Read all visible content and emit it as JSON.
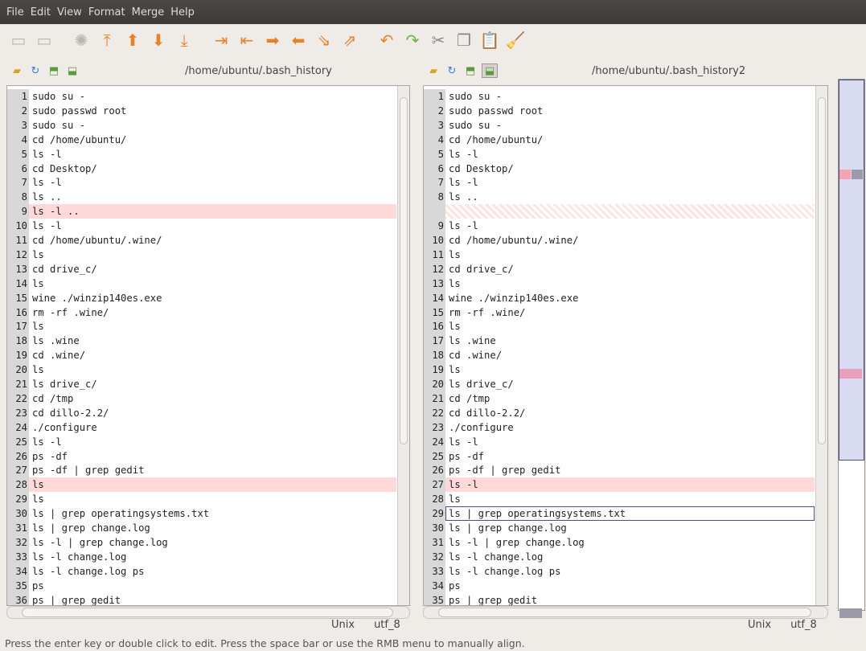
{
  "menu": [
    "File",
    "Edit",
    "View",
    "Format",
    "Merge",
    "Help"
  ],
  "toolbar": {
    "icons": [
      "new-file-icon",
      "open-file-icon",
      "spinner-icon",
      "move-first-change-icon",
      "move-prev-change-icon",
      "move-next-change-icon",
      "move-last-change-icon",
      "copy-right-icon",
      "copy-left-right-icon",
      "copy-right-arrow-icon",
      "copy-left-icon",
      "copy-all-icon",
      "merge-icon",
      "undo-icon",
      "redo-icon",
      "cut-icon",
      "copy-icon",
      "paste-icon",
      "clear-icon"
    ]
  },
  "left": {
    "path": "/home/ubuntu/.bash_history",
    "encoding_eol": "Unix",
    "encoding": "utf_8",
    "lines": [
      {
        "n": "1",
        "t": "sudo su -"
      },
      {
        "n": "2",
        "t": "sudo passwd root"
      },
      {
        "n": "3",
        "t": "sudo su -"
      },
      {
        "n": "4",
        "t": "cd /home/ubuntu/"
      },
      {
        "n": "5",
        "t": "ls -l"
      },
      {
        "n": "6",
        "t": "cd Desktop/"
      },
      {
        "n": "7",
        "t": "ls -l"
      },
      {
        "n": "8",
        "t": "ls .."
      },
      {
        "n": "9",
        "t": "ls -l ..",
        "chg": true
      },
      {
        "n": "10",
        "t": "ls -l"
      },
      {
        "n": "11",
        "t": "cd /home/ubuntu/.wine/"
      },
      {
        "n": "12",
        "t": "ls"
      },
      {
        "n": "13",
        "t": "cd drive_c/"
      },
      {
        "n": "14",
        "t": "ls"
      },
      {
        "n": "15",
        "t": "wine ./winzip140es.exe"
      },
      {
        "n": "16",
        "t": "rm -rf .wine/"
      },
      {
        "n": "17",
        "t": "ls"
      },
      {
        "n": "18",
        "t": "ls .wine"
      },
      {
        "n": "19",
        "t": "cd .wine/"
      },
      {
        "n": "20",
        "t": "ls"
      },
      {
        "n": "21",
        "t": "ls drive_c/"
      },
      {
        "n": "22",
        "t": "cd /tmp"
      },
      {
        "n": "23",
        "t": "cd dillo-2.2/"
      },
      {
        "n": "24",
        "t": "./configure"
      },
      {
        "n": "25",
        "t": "ls -l"
      },
      {
        "n": "26",
        "t": "ps -df"
      },
      {
        "n": "27",
        "t": "ps -df | grep gedit"
      },
      {
        "n": "28",
        "t": "ls",
        "chg": true
      },
      {
        "n": "29",
        "t": "ls"
      },
      {
        "n": "30",
        "t": "ls | grep operatingsystems.txt"
      },
      {
        "n": "31",
        "t": "ls | grep change.log"
      },
      {
        "n": "32",
        "t": "ls -l | grep change.log"
      },
      {
        "n": "33",
        "t": "ls -l change.log"
      },
      {
        "n": "34",
        "t": "ls -l change.log ps"
      },
      {
        "n": "35",
        "t": "ps"
      },
      {
        "n": "36",
        "t": "ps | grep gedit"
      }
    ]
  },
  "right": {
    "path": "/home/ubuntu/.bash_history2",
    "encoding_eol": "Unix",
    "encoding": "utf_8",
    "lines": [
      {
        "n": "1",
        "t": "sudo su -"
      },
      {
        "n": "2",
        "t": "sudo passwd root"
      },
      {
        "n": "3",
        "t": "sudo su -"
      },
      {
        "n": "4",
        "t": "cd /home/ubuntu/"
      },
      {
        "n": "5",
        "t": "ls -l"
      },
      {
        "n": "6",
        "t": "cd Desktop/"
      },
      {
        "n": "7",
        "t": "ls -l"
      },
      {
        "n": "8",
        "t": "ls .."
      },
      {
        "n": "",
        "t": "",
        "filler": true
      },
      {
        "n": "9",
        "t": "ls -l"
      },
      {
        "n": "10",
        "t": "cd /home/ubuntu/.wine/"
      },
      {
        "n": "11",
        "t": "ls"
      },
      {
        "n": "12",
        "t": "cd drive_c/"
      },
      {
        "n": "13",
        "t": "ls"
      },
      {
        "n": "14",
        "t": "wine ./winzip140es.exe"
      },
      {
        "n": "15",
        "t": "rm -rf .wine/"
      },
      {
        "n": "16",
        "t": "ls"
      },
      {
        "n": "17",
        "t": "ls .wine"
      },
      {
        "n": "18",
        "t": "cd .wine/"
      },
      {
        "n": "19",
        "t": "ls"
      },
      {
        "n": "20",
        "t": "ls drive_c/"
      },
      {
        "n": "21",
        "t": "cd /tmp"
      },
      {
        "n": "22",
        "t": "cd dillo-2.2/"
      },
      {
        "n": "23",
        "t": "./configure"
      },
      {
        "n": "24",
        "t": "ls -l"
      },
      {
        "n": "25",
        "t": "ps -df"
      },
      {
        "n": "26",
        "t": "ps -df | grep gedit"
      },
      {
        "n": "27",
        "t": "ls -l",
        "chg": true
      },
      {
        "n": "28",
        "t": "ls"
      },
      {
        "n": "29",
        "t": "ls | grep operatingsystems.txt",
        "cur": true
      },
      {
        "n": "30",
        "t": "ls | grep change.log"
      },
      {
        "n": "31",
        "t": "ls -l | grep change.log"
      },
      {
        "n": "32",
        "t": "ls -l change.log"
      },
      {
        "n": "33",
        "t": "ls -l change.log ps"
      },
      {
        "n": "34",
        "t": "ps"
      },
      {
        "n": "35",
        "t": "ps | grep gedit"
      }
    ]
  },
  "status": "Press the enter key or double click to edit.  Press the space bar or use the RMB menu to manually align.",
  "colors": {
    "change": "#ffd9d9",
    "current_outline": "#4a4aa0",
    "menubar": "#3c3b37"
  }
}
